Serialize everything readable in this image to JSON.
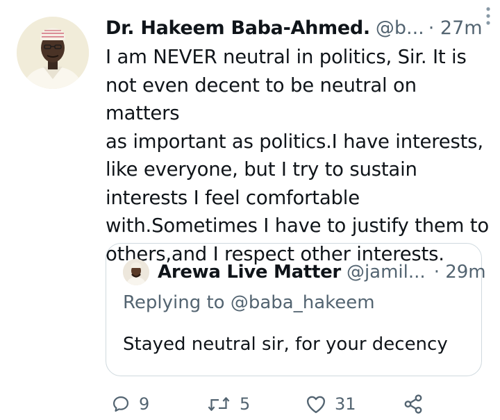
{
  "tweet": {
    "author_name": "Dr. Hakeem Baba-Ahmed.",
    "author_handle": "@b...",
    "time": "· 27m",
    "text": "I am NEVER neutral in politics, Sir. It is\nnot even decent to be neutral on matters\nas important as politics.I have interests,\nlike everyone, but I try to sustain\ninterests I  feel comfortable\nwith.Sometimes I have to justify them to\nothers,and I respect other interests."
  },
  "quoted": {
    "author_name": "Arewa Live Matter",
    "author_handle": "@jamil...",
    "time": "· 29m",
    "replying_to": "Replying to @baba_hakeem",
    "text": "Stayed neutral sir, for your decency"
  },
  "actions": {
    "replies": "9",
    "retweets": "5",
    "likes": "31"
  },
  "icons": {
    "reply": "reply-icon",
    "retweet": "retweet-icon",
    "like": "heart-icon",
    "share": "share-icon",
    "more": "more-vertical-icon"
  },
  "colors": {
    "text": "#0f1419",
    "secondary": "#536471",
    "border": "#cfd9de"
  }
}
